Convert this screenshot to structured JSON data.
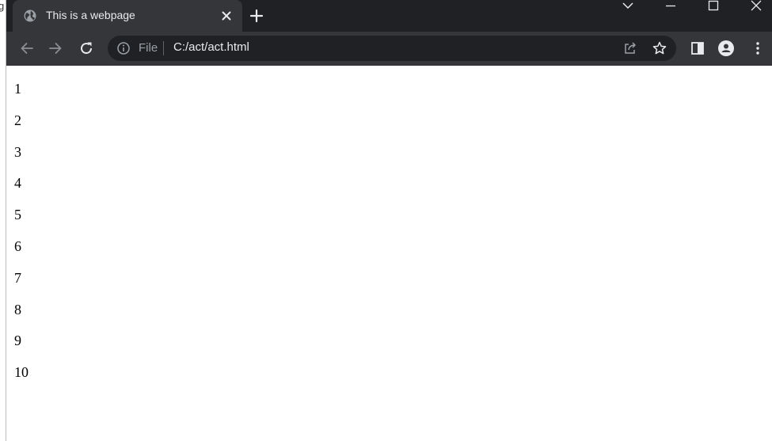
{
  "tab": {
    "title": "This is a webpage",
    "favicon": "globe-icon",
    "close": "close-icon"
  },
  "new_tab": "plus-icon",
  "window_controls": [
    "chevron-down-icon",
    "minimize-icon",
    "maximize-icon",
    "close-window-icon"
  ],
  "toolbar": {
    "back": "back-arrow-icon",
    "forward": "forward-arrow-icon",
    "reload": "reload-icon"
  },
  "omnibox": {
    "scheme_label": "File",
    "url": "C:/act/act.html",
    "share": "share-icon",
    "bookmark": "star-icon"
  },
  "toolbar_right": [
    "side-panel-icon",
    "profile-icon",
    "menu-icon"
  ],
  "left_strip_text": "gi",
  "content": {
    "items": [
      "1",
      "2",
      "3",
      "4",
      "5",
      "6",
      "7",
      "8",
      "9",
      "10"
    ]
  },
  "colors": {
    "tabstrip": "#202124",
    "toolbar": "#35363a",
    "omnibox": "#202124",
    "text_light": "#e8eaed",
    "text_muted": "#9aa0a6"
  }
}
